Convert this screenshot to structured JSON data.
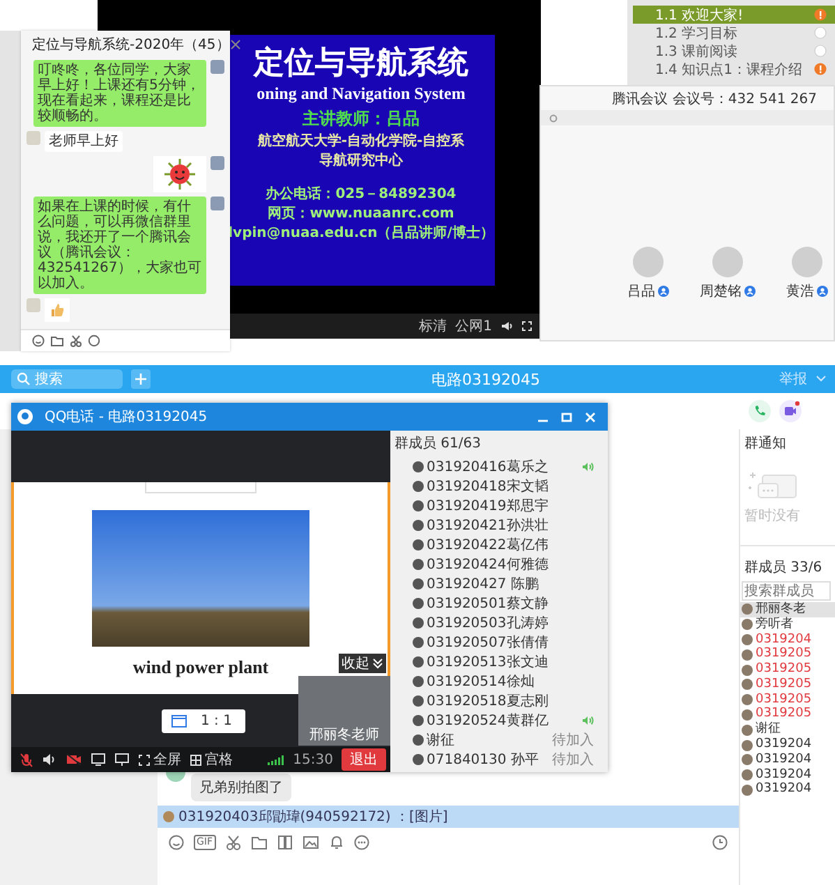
{
  "wechat_window": {
    "title": "定位与导航系统-2020年（45）",
    "messages": [
      {
        "kind": "text",
        "outgoing": true,
        "text": "叮咚咚，各位同学，大家早上好！上课还有5分钟，现在看起来，课程还是比较顺畅的。"
      },
      {
        "kind": "text",
        "outgoing": false,
        "text": "老师早上好"
      },
      {
        "kind": "sticker",
        "outgoing": true
      },
      {
        "kind": "text",
        "outgoing": true,
        "text": "如果在上课的时候，有什么问题，可以再微信群里说，我还开了一个腾讯会议（腾讯会议：432541267），大家也可以加入。"
      },
      {
        "kind": "emoji",
        "outgoing": false
      }
    ]
  },
  "lecture_video": {
    "slide_lines": [
      {
        "kind": "title",
        "text": "定位与导航系统"
      },
      {
        "kind": "subtitle",
        "text": "oning and Navigation System"
      },
      {
        "kind": "teacher",
        "text": "主讲教师：吕品"
      },
      {
        "kind": "org",
        "text": "航空航天大学-自动化学院-自控系"
      },
      {
        "kind": "org",
        "text": "导航研究中心"
      },
      {
        "kind": "contact",
        "text": "办公电话：025－84892304"
      },
      {
        "kind": "contact",
        "text": "网页：www.nuaanrc.com"
      },
      {
        "kind": "contact",
        "text": "lvpin@nuaa.edu.cn（吕品讲师/博士）"
      }
    ],
    "quality": "标清",
    "line": "公网1"
  },
  "course_outline": {
    "items": [
      {
        "label": "1.1 欢迎大家!",
        "selected": true,
        "alert": true
      },
      {
        "label": "1.2 学习目标",
        "selected": false,
        "alert": false
      },
      {
        "label": "1.3 课前阅读",
        "selected": false,
        "alert": false
      },
      {
        "label": "1.4 知识点1：课程介绍",
        "selected": false,
        "alert": true
      }
    ]
  },
  "meeting": {
    "meeting_id": "腾讯会议 会议号：432 541 267",
    "participants": [
      {
        "name": "吕品"
      },
      {
        "name": "周楚铭"
      },
      {
        "name": "黄浩"
      }
    ]
  },
  "group_chat": {
    "search": {
      "placeholder": "搜索"
    },
    "title": "电路03192045",
    "report": "举报",
    "notice_title": "群通知",
    "notice_empty": "暂时没有",
    "members_title": "群成员 33/6",
    "member_search": {
      "placeholder": "搜索群成员"
    },
    "members": [
      {
        "name": "邢丽冬老",
        "color": "#333333",
        "selected": true
      },
      {
        "name": "旁听者",
        "color": "#333333",
        "selected": false
      },
      {
        "name": "0319204",
        "color": "#e0393e",
        "selected": false
      },
      {
        "name": "0319205",
        "color": "#e0393e",
        "selected": false
      },
      {
        "name": "0319205",
        "color": "#e0393e",
        "selected": false
      },
      {
        "name": "0319205",
        "color": "#e0393e",
        "selected": false
      },
      {
        "name": "0319205",
        "color": "#e0393e",
        "selected": false
      },
      {
        "name": "0319205",
        "color": "#e0393e",
        "selected": false
      },
      {
        "name": "谢征",
        "color": "#333333",
        "selected": false
      },
      {
        "name": "0319204",
        "color": "#333333",
        "selected": false
      },
      {
        "name": "0319204",
        "color": "#333333",
        "selected": false
      },
      {
        "name": "0319204",
        "color": "#333333",
        "selected": false
      },
      {
        "name": "0319204",
        "color": "#333333",
        "selected": false
      }
    ],
    "message": "兄弟别拍图了",
    "quote": "031920403邱勖瑋(940592172) ：[图片]",
    "gif_label": "GIF"
  },
  "call_window": {
    "title": "QQ电话 - 电路03192045",
    "caption": "wind power plant",
    "collapse": "收起",
    "ratio": "1 : 1",
    "presenter": "邢丽冬老师",
    "fullscreen": "全屏",
    "grid": "宫格",
    "time": "15:30",
    "exit": "退出",
    "members_title": "群成员 61/63",
    "members": [
      {
        "name": "031920416葛乐之",
        "speaking": true
      },
      {
        "name": "031920418宋文韬",
        "speaking": false
      },
      {
        "name": "031920419郑思宇",
        "speaking": false
      },
      {
        "name": "031920421孙洪壮",
        "speaking": false
      },
      {
        "name": "031920422葛亿伟",
        "speaking": false
      },
      {
        "name": "031920424何雅德",
        "speaking": false
      },
      {
        "name": "031920427 陈鹏",
        "speaking": false
      },
      {
        "name": "031920501蔡文静",
        "speaking": false
      },
      {
        "name": "031920503孔涛婷",
        "speaking": false
      },
      {
        "name": "031920507张倩倩",
        "speaking": false
      },
      {
        "name": "031920513张文迪",
        "speaking": false
      },
      {
        "name": "031920514徐灿",
        "speaking": false
      },
      {
        "name": "031920518夏志刚",
        "speaking": false
      },
      {
        "name": "031920524黄群亿",
        "speaking": true
      },
      {
        "name": "谢征",
        "speaking": false,
        "status": "待加入"
      },
      {
        "name": "071840130 孙平",
        "speaking": false,
        "status": "待加入"
      }
    ]
  }
}
